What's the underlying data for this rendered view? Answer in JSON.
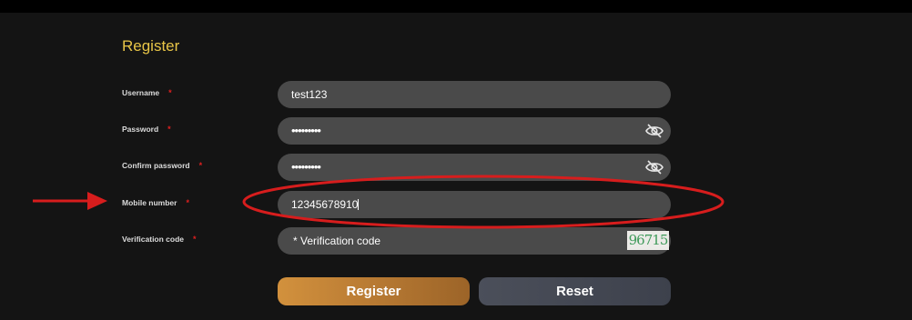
{
  "form": {
    "title": "Register",
    "required_mark": "*",
    "username": {
      "label": "Username",
      "value": "test123"
    },
    "password": {
      "label": "Password",
      "value": "•••••••••"
    },
    "confirm_password": {
      "label": "Confirm password",
      "value": "•••••••••"
    },
    "mobile": {
      "label": "Mobile number",
      "value": "12345678910"
    },
    "verification": {
      "label": "Verification code",
      "placeholder": "* Verification code",
      "captcha_text": "96715"
    }
  },
  "buttons": {
    "register": "Register",
    "reset": "Reset"
  },
  "icons": {
    "password_toggle": "eye-slash-icon",
    "annotation_arrow": "red-arrow-icon"
  },
  "colors": {
    "title": "#e8c547",
    "required": "#e02020",
    "annotation": "#d71d1d",
    "register_button": "#b87a33",
    "reset_button": "#444852",
    "field_bg": "#4a4a4a",
    "page_bg": "#141414"
  }
}
